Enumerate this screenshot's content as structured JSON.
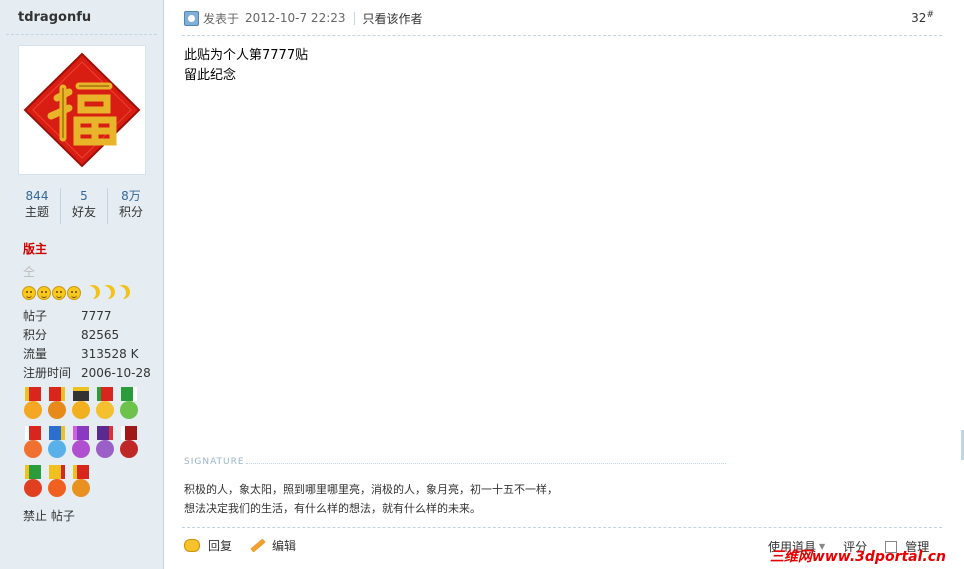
{
  "user": {
    "name": "tdragonfu",
    "stats": [
      {
        "value": "844",
        "label": "主题"
      },
      {
        "value": "5",
        "label": "好友"
      },
      {
        "value": "8万",
        "label": "积分"
      }
    ],
    "rank": "版主",
    "star_row": "仝",
    "info": [
      {
        "key": "帖子",
        "value": "7777"
      },
      {
        "key": "积分",
        "value": "82565"
      },
      {
        "key": "流量",
        "value": "313528 K"
      },
      {
        "key": "注册时间",
        "value": "2006-10-28"
      }
    ],
    "ban_text": "禁止 帖子"
  },
  "post": {
    "posted_label": "发表于",
    "date": "2012-10-7 22:23",
    "author_only": "只看该作者",
    "floor": "32",
    "floor_mark": "#",
    "lines": [
      "此贴为个人第7777贴",
      "留此纪念"
    ],
    "signature_label": "SIGNATURE",
    "signature": [
      "积极的人，象太阳，照到哪里哪里亮，消极的人，象月亮，初一十五不一样，",
      "想法决定我们的生活，有什么样的想法，就有什么样的未来。"
    ]
  },
  "actions": {
    "reply": "回复",
    "edit": "编辑",
    "use_tool": "使用道具",
    "rate": "评分",
    "manage": "管理"
  },
  "watermark": "三维网www.3dportal.cn",
  "colors": {
    "sidebar_bg": "#e5edf2",
    "rank": "#cc0000",
    "link": "#336699",
    "watermark": "#e60000"
  }
}
